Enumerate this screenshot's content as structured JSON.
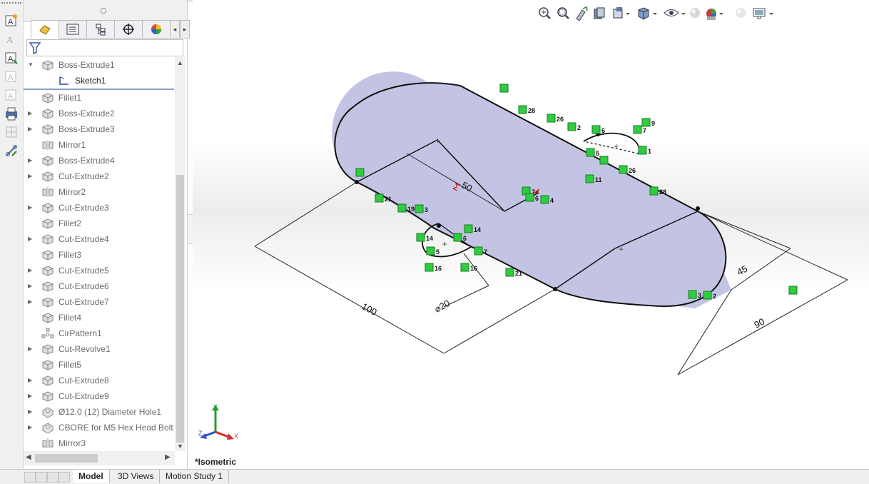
{
  "feature_tree": {
    "items": [
      {
        "label": "Boss-Extrude1",
        "icon": "extrude-icon",
        "expanded": true
      },
      {
        "label": "Sketch1",
        "icon": "sketch-icon",
        "child": true
      },
      {
        "label": "Fillet1",
        "icon": "fillet-icon"
      },
      {
        "label": "Boss-Extrude2",
        "icon": "extrude-icon"
      },
      {
        "label": "Boss-Extrude3",
        "icon": "extrude-icon"
      },
      {
        "label": "Mirror1",
        "icon": "mirror-icon"
      },
      {
        "label": "Boss-Extrude4",
        "icon": "extrude-icon"
      },
      {
        "label": "Cut-Extrude2",
        "icon": "cut-extrude-icon"
      },
      {
        "label": "Mirror2",
        "icon": "mirror-icon"
      },
      {
        "label": "Cut-Extrude3",
        "icon": "cut-extrude-icon"
      },
      {
        "label": "Fillet2",
        "icon": "fillet-icon"
      },
      {
        "label": "Cut-Extrude4",
        "icon": "cut-extrude-icon"
      },
      {
        "label": "Fillet3",
        "icon": "fillet-icon"
      },
      {
        "label": "Cut-Extrude5",
        "icon": "cut-extrude-icon"
      },
      {
        "label": "Cut-Extrude6",
        "icon": "cut-extrude-icon"
      },
      {
        "label": "Cut-Extrude7",
        "icon": "cut-extrude-icon"
      },
      {
        "label": "Fillet4",
        "icon": "fillet-icon"
      },
      {
        "label": "CirPattern1",
        "icon": "circular-pattern-icon"
      },
      {
        "label": "Cut-Revolve1",
        "icon": "revolve-icon"
      },
      {
        "label": "Fillet5",
        "icon": "fillet-icon"
      },
      {
        "label": "Cut-Extrude8",
        "icon": "cut-extrude-icon"
      },
      {
        "label": "Cut-Extrude9",
        "icon": "cut-extrude-icon"
      },
      {
        "label": "Ø12.0 (12) Diameter Hole1",
        "icon": "hole-icon"
      },
      {
        "label": "CBORE for M5 Hex Head Bolt1",
        "icon": "hole-icon"
      },
      {
        "label": "Mirror3",
        "icon": "mirror-icon"
      }
    ]
  },
  "bottom_tabs": [
    "Model",
    "3D Views",
    "Motion Study 1"
  ],
  "viewport": {
    "view_label": "*Isometric",
    "dimensions": {
      "d50": "50",
      "d100": "100",
      "d20": "⌀20",
      "d45": "45",
      "d90": "90",
      "sigma": "Σ"
    },
    "triad": {
      "x": "X",
      "y": "Y",
      "z": "Z"
    },
    "relation_numbers": [
      "28",
      "26",
      "2",
      "9",
      "7",
      "6",
      "5",
      "11",
      "1",
      "26",
      "28",
      "21",
      "19",
      "3",
      "7",
      "6",
      "4",
      "14",
      "14",
      "6",
      "5",
      "7",
      "16",
      "16",
      "21",
      "3",
      "2"
    ],
    "colors": {
      "sketch_fill": "#c3c4e3",
      "relation_green": "#2ecc40",
      "dim_red": "#d00000"
    }
  }
}
